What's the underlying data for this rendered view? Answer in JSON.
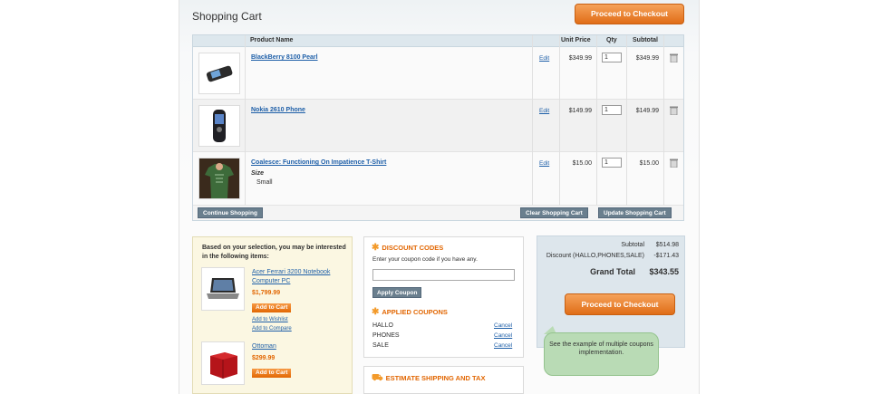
{
  "page": {
    "title": "Shopping Cart",
    "checkout_label": "Proceed to Checkout"
  },
  "table": {
    "headers": {
      "name": "Product Name",
      "price": "Unit Price",
      "qty": "Qty",
      "subtotal": "Subtotal"
    },
    "rows": [
      {
        "name": "BlackBerry 8100 Pearl",
        "edit": "Edit",
        "price": "$349.99",
        "qty": "1",
        "subtotal": "$349.99",
        "image": "phone-pearl-image"
      },
      {
        "name": "Nokia 2610 Phone",
        "edit": "Edit",
        "price": "$149.99",
        "qty": "1",
        "subtotal": "$149.99",
        "image": "phone-nokia-image"
      },
      {
        "name": "Coalesce: Functioning On Impatience T-Shirt",
        "edit": "Edit",
        "price": "$15.00",
        "qty": "1",
        "subtotal": "$15.00",
        "image": "tshirt-image",
        "option_label": "Size",
        "option_value": "Small"
      }
    ],
    "footer": {
      "continue": "Continue Shopping",
      "clear": "Clear Shopping Cart",
      "update": "Update Shopping Cart"
    }
  },
  "crosssell": {
    "title": "Based on your selection, you may be interested in the following items:",
    "items": [
      {
        "name": "Acer Ferrari 3200 Notebook Computer PC",
        "price": "$1,799.99",
        "add": "Add to Cart",
        "wishlist": "Add to Wishlist",
        "compare": "Add to Compare"
      },
      {
        "name": "Ottoman",
        "price": "$299.99",
        "add": "Add to Cart"
      }
    ]
  },
  "discount": {
    "title": "DISCOUNT CODES",
    "help": "Enter your coupon code if you have any.",
    "input_value": "",
    "apply": "Apply Coupon",
    "applied_title": "APPLIED COUPONS",
    "coupons": [
      {
        "code": "HALLO",
        "cancel": "Cancel"
      },
      {
        "code": "PHONES",
        "cancel": "Cancel"
      },
      {
        "code": "SALE",
        "cancel": "Cancel"
      }
    ]
  },
  "shipping": {
    "title": "ESTIMATE SHIPPING AND TAX"
  },
  "totals": {
    "subtotal_label": "Subtotal",
    "subtotal": "$514.98",
    "discount_label": "Discount (HALLO,PHONES,SALE)",
    "discount": "-$171.43",
    "grand_label": "Grand Total",
    "grand": "$343.55"
  },
  "tooltip": {
    "text": "See the example of multiple coupons implementation."
  },
  "colors": {
    "accent": "#e26703",
    "link": "#1e5fa8",
    "grey_button": "#6a7f8e",
    "tooltip": "#b9dbb5"
  }
}
